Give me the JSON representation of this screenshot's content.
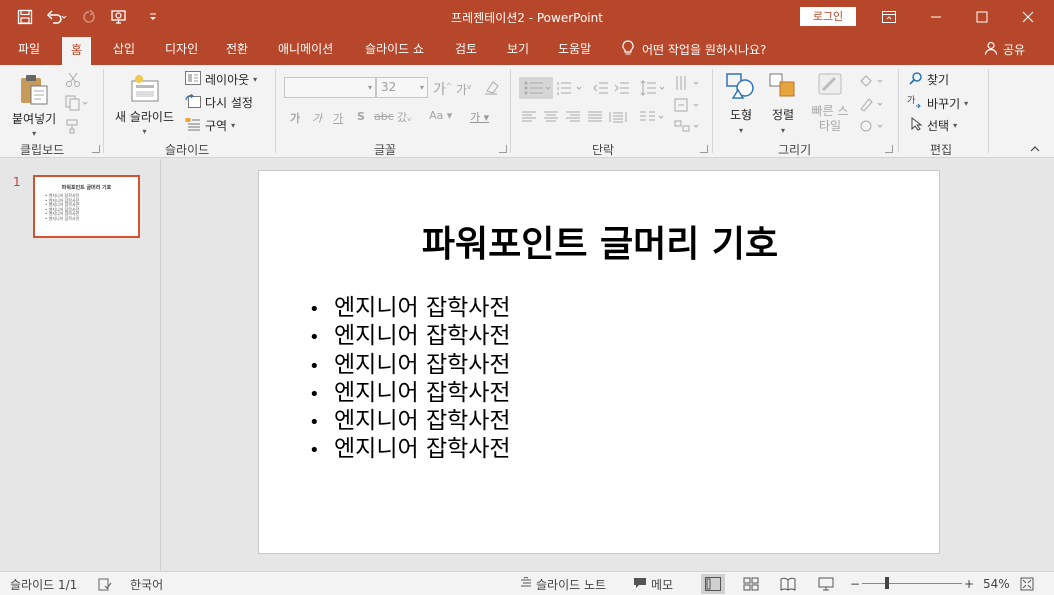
{
  "app": {
    "doc_title": "프레젠테이션2  -  PowerPoint",
    "login_label": "로그인"
  },
  "tabs": [
    {
      "label": "파일"
    },
    {
      "label": "홈"
    },
    {
      "label": "삽입"
    },
    {
      "label": "디자인"
    },
    {
      "label": "전환"
    },
    {
      "label": "애니메이션"
    },
    {
      "label": "슬라이드 쇼"
    },
    {
      "label": "검토"
    },
    {
      "label": "보기"
    },
    {
      "label": "도움말"
    }
  ],
  "active_tab": "홈",
  "tell_me": "어떤 작업을 원하시나요?",
  "share_label": "공유",
  "ribbon": {
    "clipboard": {
      "paste": "붙여넣기",
      "group": "클립보드"
    },
    "slides": {
      "new_slide": "새 슬라이드",
      "layout": "레이아웃",
      "reset": "다시 설정",
      "section": "구역",
      "group": "슬라이드"
    },
    "font": {
      "size": "32",
      "group": "글꼴"
    },
    "paragraph": {
      "group": "단락"
    },
    "drawing": {
      "shapes": "도형",
      "arrange": "정렬",
      "quick_styles": "빠른 스타일",
      "group": "그리기"
    },
    "editing": {
      "find": "찾기",
      "replace": "바꾸기",
      "select": "선택",
      "group": "편집"
    }
  },
  "thumbnail": {
    "number": "1",
    "title": "파워포인트 글머리 기호",
    "items": [
      "엔지니어 잡학사전",
      "엔지니어 잡학사전",
      "엔지니어 잡학사전",
      "엔지니어 잡학사전",
      "엔지니어 잡학사전",
      "엔지니어 잡학사전"
    ]
  },
  "slide": {
    "title": "파워포인트 글머리 기호",
    "bullets": [
      "엔지니어 잡학사전",
      "엔지니어 잡학사전",
      "엔지니어 잡학사전",
      "엔지니어 잡학사전",
      "엔지니어 잡학사전",
      "엔지니어 잡학사전"
    ]
  },
  "status": {
    "slide_count": "슬라이드 1/1",
    "language": "한국어",
    "notes": "슬라이드 노트",
    "comments": "메모",
    "zoom": "54%"
  },
  "colors": {
    "accent": "#b7472a",
    "thumb_border": "#d35230"
  }
}
